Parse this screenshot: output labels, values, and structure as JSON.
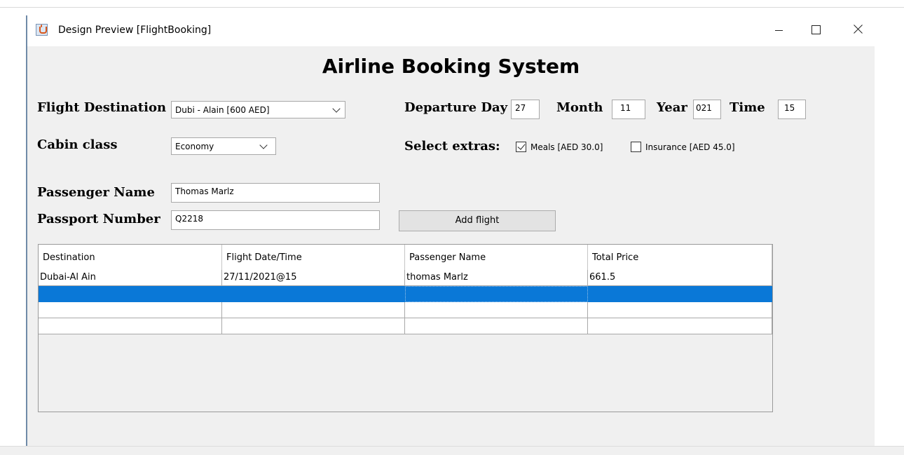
{
  "window": {
    "title": "Design Preview [FlightBooking]"
  },
  "heading": "Airline Booking System",
  "form": {
    "destination_label": "Flight Destination",
    "destination_value": "Dubi - Alain [600 AED]",
    "cabin_label": "Cabin class",
    "cabin_value": "Economy",
    "departure_day_label": "Departure Day",
    "day_value": "27",
    "month_label": "Month",
    "month_value": "11",
    "year_label": "Year",
    "year_value": "021",
    "time_label": "Time",
    "time_value": "15",
    "extras_label": "Select extras:",
    "meals_label": "Meals [AED 30.0]",
    "meals_checked": true,
    "insurance_label": "Insurance [AED 45.0]",
    "insurance_checked": false,
    "passenger_name_label": "Passenger Name",
    "passenger_name_value": "Thomas Marlz",
    "passport_label": "Passport Number",
    "passport_value": "Q2218",
    "add_button": "Add flight"
  },
  "table": {
    "headers": [
      "Destination",
      "Flight Date/Time",
      "Passenger Name",
      "Total Price"
    ],
    "rows": [
      [
        "Dubai-Al Ain",
        "27/11/2021@15",
        "thomas Marlz",
        "661.5"
      ],
      [
        "",
        "",
        "",
        ""
      ],
      [
        "",
        "",
        "",
        ""
      ],
      [
        "",
        "",
        "",
        ""
      ]
    ],
    "selected_row": 1
  },
  "colors": {
    "selection": "#0a78d7",
    "window_bg": "#f0f0f0"
  }
}
